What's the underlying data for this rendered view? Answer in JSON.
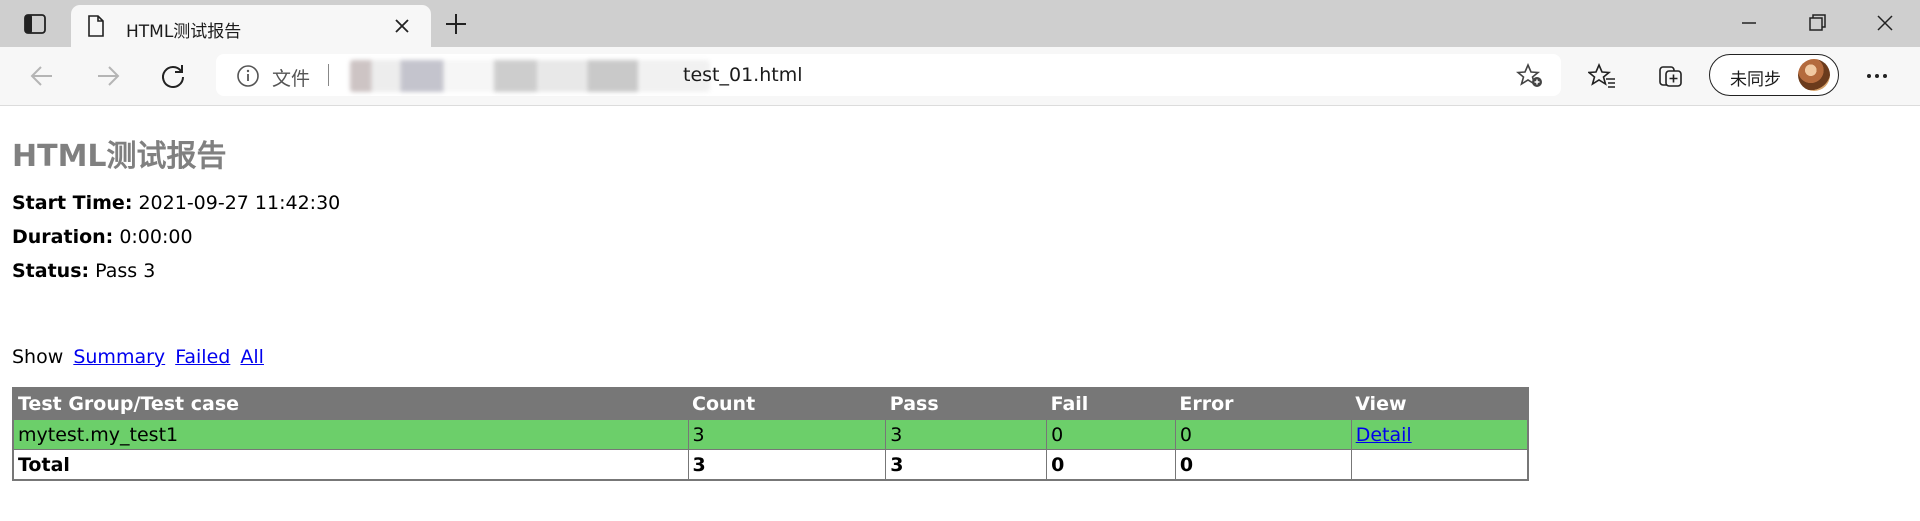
{
  "browser": {
    "tab_title": "HTML测试报告",
    "address_scheme_label": "文件",
    "address_url_visible": "test_01.html",
    "sync_label": "未同步"
  },
  "report": {
    "title": "HTML测试报告",
    "meta": [
      {
        "key": "Start Time:",
        "value": "2021-09-27 11:42:30"
      },
      {
        "key": "Duration:",
        "value": "0:00:00"
      },
      {
        "key": "Status:",
        "value": "Pass 3"
      }
    ],
    "show": {
      "label": "Show",
      "links": [
        "Summary",
        "Failed",
        "All"
      ]
    },
    "table": {
      "headers": [
        "Test Group/Test case",
        "Count",
        "Pass",
        "Fail",
        "Error",
        "View"
      ],
      "rows": [
        {
          "cells": [
            "mytest.my_test1",
            "3",
            "3",
            "0",
            "0",
            "Detail"
          ]
        }
      ],
      "total": [
        "Total",
        "3",
        "3",
        "0",
        "0",
        ""
      ]
    }
  },
  "colors": {
    "header_bg": "#777777",
    "pass_row_bg": "#6ccf6a",
    "title_gray": "#808080",
    "link_blue": "#0000ee"
  },
  "icons": {
    "tab": "tab-actions-icon",
    "favicon": "document-icon",
    "close": "close-icon",
    "new_tab": "plus-icon",
    "back": "back-arrow-icon",
    "forward": "forward-arrow-icon",
    "reload": "reload-icon",
    "info": "info-icon",
    "add_favorite": "add-favorite-icon",
    "favorites": "favorites-icon",
    "collections": "collections-icon",
    "more": "more-icon"
  }
}
